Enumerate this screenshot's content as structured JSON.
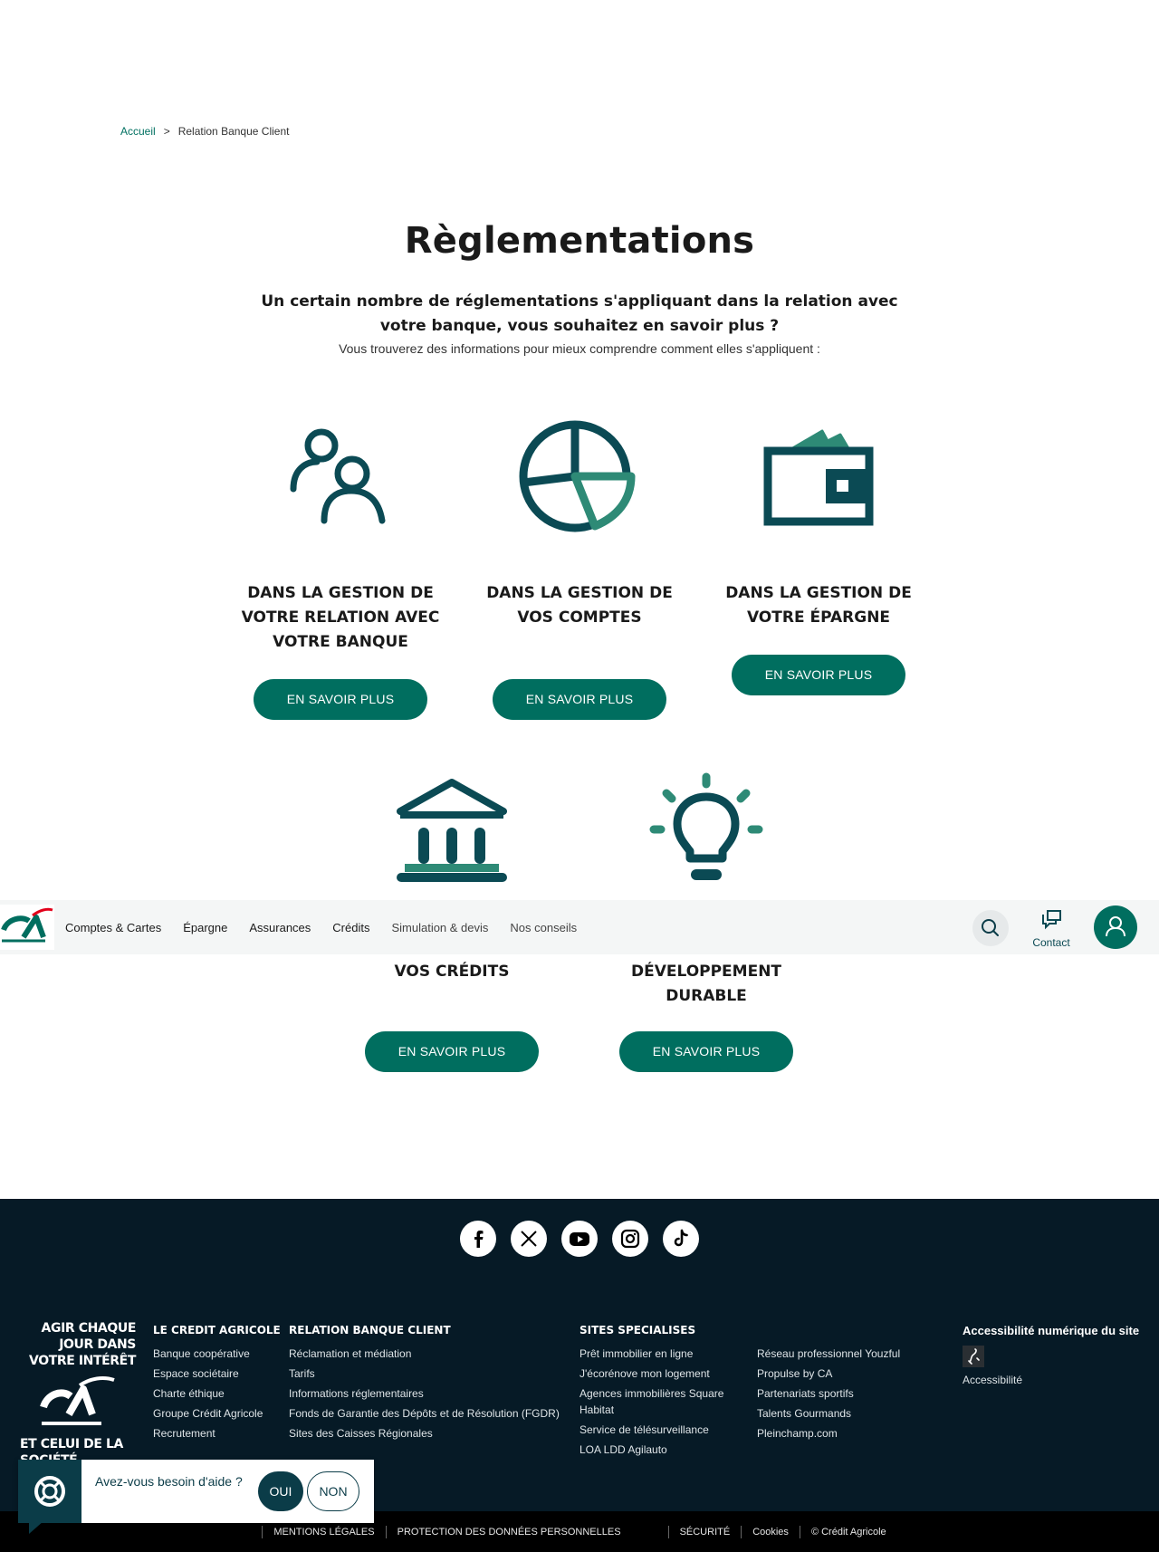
{
  "breadcrumb": {
    "home": "Accueil",
    "separator": ">",
    "current": "Relation Banque Client"
  },
  "hero": {
    "title": "Règlementations",
    "lead": "Un certain nombre de réglementations s'appliquant dans la relation avec votre banque, vous souhaitez en savoir plus ?",
    "sub": "Vous trouverez des informations pour mieux comprendre comment elles s'appliquent :"
  },
  "cards": [
    {
      "title": "DANS LA GESTION DE VOTRE RELATION AVEC VOTRE BANQUE",
      "button": "EN SAVOIR PLUS",
      "icon": "people-icon"
    },
    {
      "title": "DANS LA GESTION DE VOS COMPTES",
      "button": "EN SAVOIR PLUS",
      "icon": "pie-chart-icon"
    },
    {
      "title": "DANS LA GESTION DE VOTRE ÉPARGNE",
      "button": "EN SAVOIR PLUS",
      "icon": "wallet-icon"
    },
    {
      "title": "VOS CRÉDITS",
      "button": "EN SAVOIR PLUS",
      "icon": "bank-icon"
    },
    {
      "title_line1": "DÉVELOPPEMENT",
      "title_line2": "DURABLE",
      "button": "EN SAVOIR PLUS",
      "icon": "lightbulb-icon"
    }
  ],
  "nav": {
    "items": [
      "Comptes & Cartes",
      "Épargne",
      "Assurances",
      "Crédits",
      "Simulation & devis",
      "Nos conseils"
    ],
    "contact": "Contact"
  },
  "footer": {
    "social": [
      "facebook-icon",
      "x-icon",
      "youtube-icon",
      "instagram-icon",
      "tiktok-icon"
    ],
    "slogan_top": "AGIR CHAQUE JOUR DANS VOTRE INTÉRÊT",
    "slogan_bottom": "ET CELUI DE LA SOCIÉTÉ",
    "col1": {
      "title": "LE CREDIT AGRICOLE",
      "links": [
        "Banque coopérative",
        "Espace sociétaire",
        "Charte éthique",
        "Groupe Crédit Agricole",
        "Recrutement"
      ]
    },
    "col2": {
      "title": "RELATION BANQUE CLIENT",
      "links": [
        "Réclamation et médiation",
        "Tarifs",
        "Informations réglementaires",
        "Fonds de Garantie des Dépôts et de Résolution (FGDR)",
        "Sites des Caisses Régionales"
      ]
    },
    "col3": {
      "title": "SITES SPECIALISES",
      "links": [
        "Prêt immobilier en ligne",
        "J'écorénove mon logement",
        "Agences immobilières Square Habitat",
        "Service de télésurveillance",
        "LOA LDD Agilauto"
      ]
    },
    "col4": {
      "links": [
        "Réseau professionnel Youzful",
        "Propulse by CA",
        "Partenariats sportifs",
        "Talents Gourmands",
        "Pleinchamp.com"
      ]
    },
    "col5": {
      "title": "Accessibilité numérique du site",
      "link": "Accessibilité"
    },
    "bottom": [
      "MENTIONS LÉGALES",
      "PROTECTION DES DONNÉES PERSONNELLES",
      "SÉCURITÉ",
      "Cookies",
      "© Crédit Agricole"
    ]
  },
  "help": {
    "question": "Avez-vous besoin d'aide ?",
    "yes": "OUI",
    "no": "NON"
  },
  "colors": {
    "primary": "#006e5f",
    "dark": "#0b4a54",
    "footer": "#061a26"
  }
}
